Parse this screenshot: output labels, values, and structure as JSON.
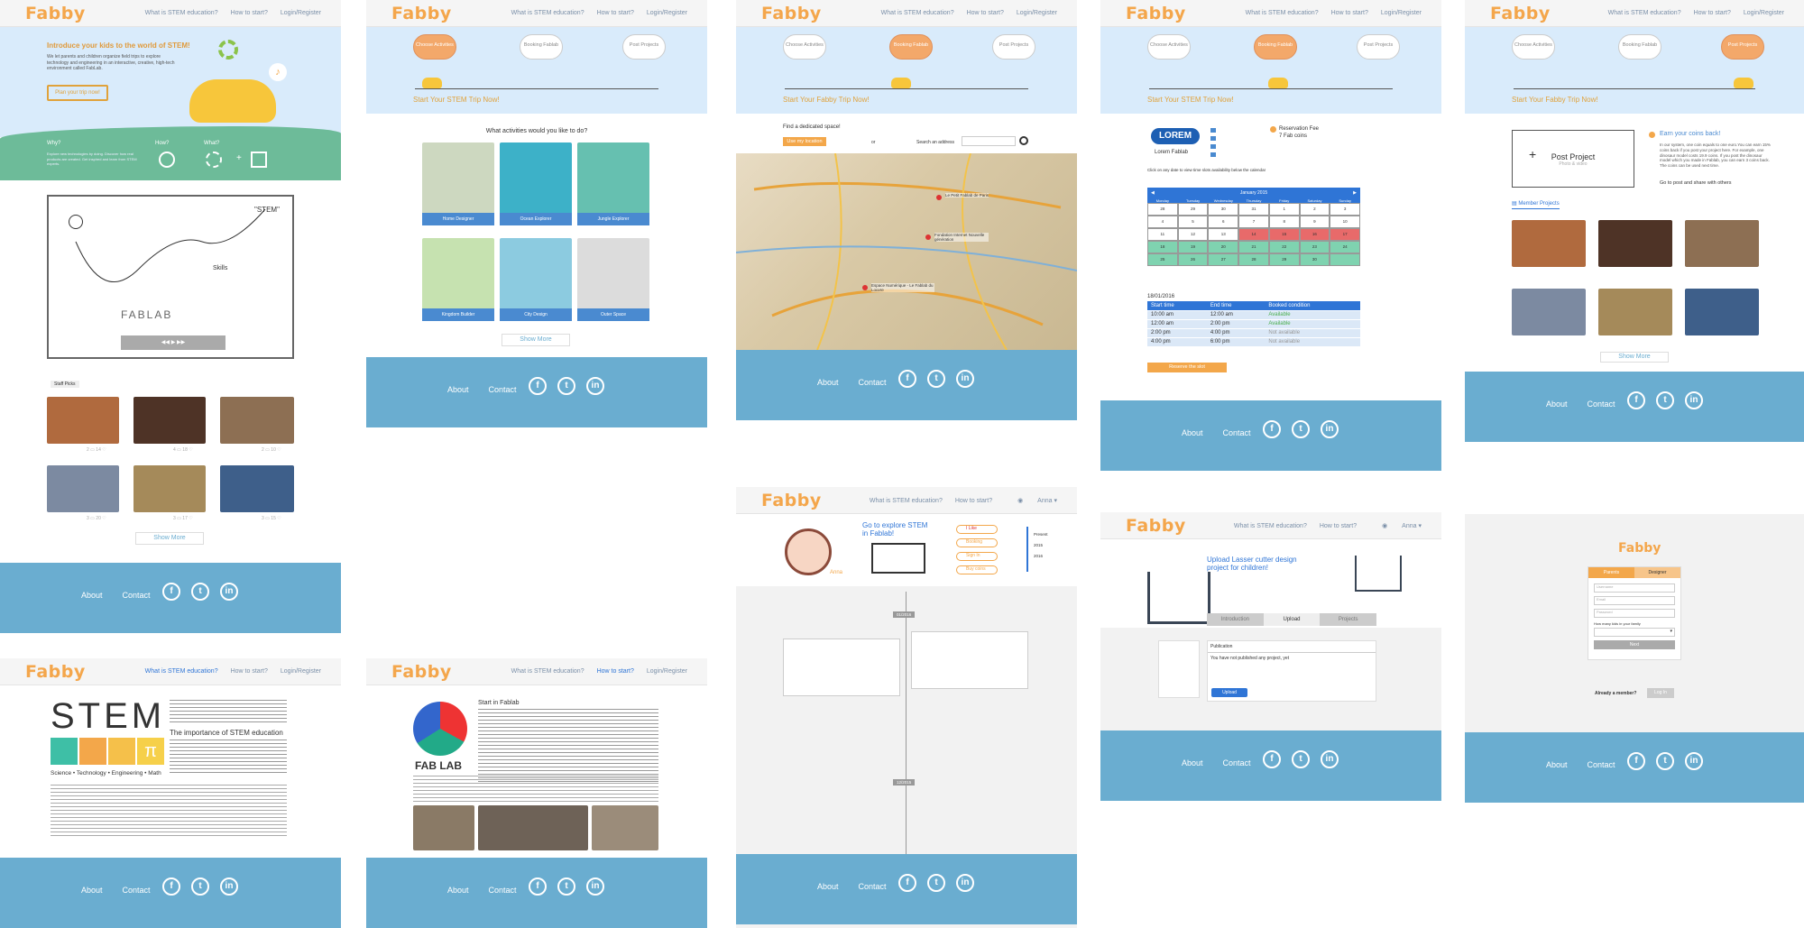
{
  "logo": "Fabby",
  "nav": {
    "stem": "What is STEM education?",
    "how": "How to start?",
    "login": "Login/Register",
    "user": "Anna"
  },
  "footer": {
    "about": "About",
    "contact": "Contact",
    "f": "f",
    "t": "t",
    "in": "in"
  },
  "home": {
    "hero_title": "Introduce your kids to the world of STEM!",
    "hero_text": "We let parents and children organize field trips to explore technology and engineering in an interactive, creative, high-tech environment called FabLab.",
    "cta": "Plan your trip now!",
    "why": "Why?",
    "how": "How?",
    "what": "What?",
    "why_text": "Explore new technologies by doing. Discover how real products are created. Get inspired and learn from STEM experts.",
    "stem_label": "\"STEM\"",
    "skills_label": "Skills",
    "fablab_label": "FABLAB",
    "staff_picks": "Staff Picks",
    "show_more": "Show More",
    "counts": [
      [
        "2",
        "14"
      ],
      [
        "4",
        "18"
      ],
      [
        "2",
        "10"
      ],
      [
        "3",
        "20"
      ],
      [
        "3",
        "17"
      ],
      [
        "3",
        "15"
      ]
    ]
  },
  "steps": {
    "choose": "Choose Activities",
    "booking": "Booking Fablab",
    "post": "Post Projects",
    "trip": "Start Your STEM Trip Now!",
    "fabby_trip": "Start Your Fabby Trip Now!"
  },
  "activities": {
    "question": "What activities would you like to do?",
    "items": [
      "Home Designer",
      "Ocean Explorer",
      "Jungle Explorer",
      "Kingdom Builder",
      "City Design",
      "Outer Space"
    ],
    "show_more": "Show More"
  },
  "map": {
    "find": "Find a dedicated space!",
    "use_location": "Use my location",
    "or": "or",
    "search": "Search an address",
    "pins": [
      "Le Petit Fablab de Paris",
      "Fondation Internet Nouvelle génération",
      "Espace Numérique - Le Fablab du Louvre"
    ]
  },
  "booking": {
    "lab_logo": "LOREM",
    "lab_name": "Lorem Fablab",
    "fee": "Reservation Fee",
    "coins": "7 Fab coins",
    "hint": "Click on any date to view time slots availability below the calendar",
    "month": "January 2015",
    "days": [
      "Monday",
      "Tuesday",
      "Wednesday",
      "Thursday",
      "Friday",
      "Saturday",
      "Sunday"
    ],
    "date": "18/01/2016",
    "headers": [
      "Start time",
      "End time",
      "Booked condition"
    ],
    "rows": [
      [
        "10:00 am",
        "12:00 am",
        "Available"
      ],
      [
        "12:00 am",
        "2:00 pm",
        "Available"
      ],
      [
        "2:00 pm",
        "4:00 pm",
        "Not available"
      ],
      [
        "4:00 pm",
        "6:00 pm",
        "Not available"
      ]
    ],
    "reserve": "Reserve the slot"
  },
  "post": {
    "post_project": "Post Project",
    "photo_video": "Photo & video",
    "earn": "Earn your coins back!",
    "earn_text": "In our system, one coin equals to one euro.You can earn 15% coins back if you post your project here. For example, one dinosaur model costs 19.9 coins. If you post the dinosaur model which you made in Fablab, you can earn 3 coins back. The coins can be used next time.",
    "go_post": "Go to post and share with others",
    "member_projects": "Member Projects",
    "show_more": "Show More"
  },
  "stem": {
    "big": "STEM",
    "tagline": "Science • Technology • Engineering • Math",
    "importance": "The importance of STEM education"
  },
  "fablab": {
    "title": "Start in Fablab",
    "logo_text": "FAB LAB"
  },
  "profile": {
    "explore": "Go to explore STEM in Fablab!",
    "name": "Anna",
    "menu": [
      "I Like",
      "Booking",
      "Sign In",
      "Buy coins"
    ],
    "years": [
      "Present",
      "2015",
      "2016"
    ],
    "date1": "01/2016",
    "date2": "12/2015"
  },
  "upload": {
    "title": "Upload Lasser cutter design project for children!",
    "tabs": [
      "Introduction",
      "Upload",
      "Projects"
    ],
    "publish": "Publication",
    "none": "You have not published any project, yet",
    "btn": "Upload"
  },
  "register": {
    "tabs": [
      "Parents",
      "Designer"
    ],
    "fields": [
      "Username",
      "Email",
      "Password"
    ],
    "kids": "How many kids in your family",
    "next": "Next",
    "member": "Already a member?",
    "login": "Log In"
  }
}
